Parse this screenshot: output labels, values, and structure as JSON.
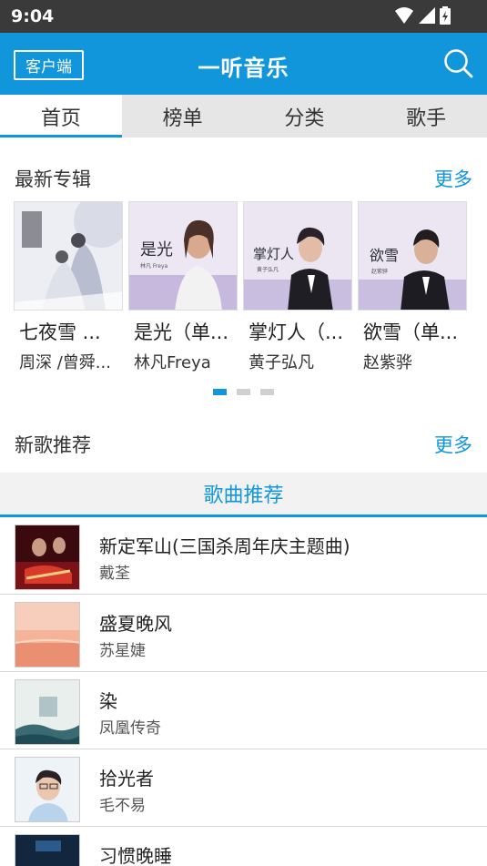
{
  "status": {
    "time": "9:04"
  },
  "header": {
    "client_label": "客户端",
    "title": "一听音乐"
  },
  "tabs": [
    {
      "label": "首页",
      "active": true
    },
    {
      "label": "榜单",
      "active": false
    },
    {
      "label": "分类",
      "active": false
    },
    {
      "label": "歌手",
      "active": false
    }
  ],
  "albums_section": {
    "title": "最新专辑",
    "more": "更多",
    "items": [
      {
        "name": "七夜雪 ...",
        "artist": "周深 /曾舜..."
      },
      {
        "name": "是光（单...",
        "artist": "林凡Freya"
      },
      {
        "name": "掌灯人（...",
        "artist": "黄子弘凡"
      },
      {
        "name": "欲雪（单...",
        "artist": "赵紫骅"
      }
    ],
    "carousel_pages": 3,
    "carousel_active": 0
  },
  "songs_section": {
    "title": "新歌推荐",
    "more": "更多",
    "tab_label": "歌曲推荐",
    "items": [
      {
        "title": "新定军山(三国杀周年庆主题曲)",
        "artist": "戴荃"
      },
      {
        "title": "盛夏晚风",
        "artist": "苏星婕"
      },
      {
        "title": "染",
        "artist": "凤凰传奇"
      },
      {
        "title": "拾光者",
        "artist": "毛不易"
      },
      {
        "title": "习惯晚睡",
        "artist": ""
      }
    ]
  },
  "colors": {
    "accent": "#1296db",
    "status_bar": "#3a3a3a",
    "tab_bg": "#e6e6e6"
  }
}
